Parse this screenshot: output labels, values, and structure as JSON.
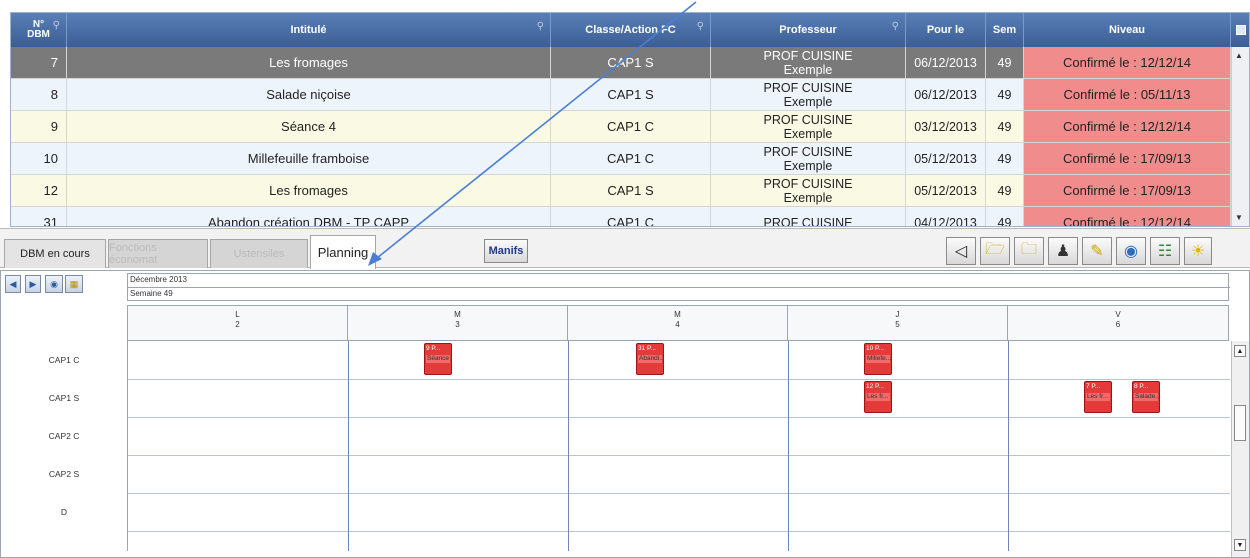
{
  "grid": {
    "headers": {
      "num_line1": "N°",
      "num_line2": "DBM",
      "intitule": "Intitulé",
      "classe": "Classe/Action FC",
      "professeur": "Professeur",
      "pour_le": "Pour le",
      "sem": "Sem",
      "niveau": "Niveau"
    },
    "rows": [
      {
        "num": "7",
        "intitule": "Les fromages",
        "classe": "CAP1 S",
        "prof_line1": "PROF CUISINE",
        "prof_line2": "Exemple",
        "pour_le": "06/12/2013",
        "sem": "49",
        "niveau": "Confirmé le : 12/12/14"
      },
      {
        "num": "8",
        "intitule": "Salade niçoise",
        "classe": "CAP1 S",
        "prof_line1": "PROF CUISINE",
        "prof_line2": "Exemple",
        "pour_le": "06/12/2013",
        "sem": "49",
        "niveau": "Confirmé le : 05/11/13"
      },
      {
        "num": "9",
        "intitule": "Séance 4",
        "classe": "CAP1 C",
        "prof_line1": "PROF CUISINE",
        "prof_line2": "Exemple",
        "pour_le": "03/12/2013",
        "sem": "49",
        "niveau": "Confirmé le : 12/12/14"
      },
      {
        "num": "10",
        "intitule": "Millefeuille framboise",
        "classe": "CAP1 C",
        "prof_line1": "PROF CUISINE",
        "prof_line2": "Exemple",
        "pour_le": "05/12/2013",
        "sem": "49",
        "niveau": "Confirmé le : 17/09/13"
      },
      {
        "num": "12",
        "intitule": "Les fromages",
        "classe": "CAP1 S",
        "prof_line1": "PROF CUISINE",
        "prof_line2": "Exemple",
        "pour_le": "05/12/2013",
        "sem": "49",
        "niveau": "Confirmé le : 17/09/13"
      },
      {
        "num": "31",
        "intitule": "Abandon création DBM - TP CAPP",
        "classe": "CAP1 C",
        "prof_line1": "PROF CUISINE",
        "prof_line2": "",
        "pour_le": "04/12/2013",
        "sem": "49",
        "niveau": "Confirmé le : 12/12/14"
      }
    ]
  },
  "tabs": {
    "dbm": "DBM en cours",
    "fonctions": "Fonctions économat",
    "ustensiles": "Ustensiles",
    "planning": "Planning",
    "manifs": "Manifs"
  },
  "toolbar_icons": [
    "basket-icon",
    "folder-open-icon",
    "folder-icon",
    "person-board-icon",
    "edit-folder-icon",
    "search-globe-icon",
    "tree-icon",
    "lightbulb-icon"
  ],
  "planning": {
    "month": "Décembre 2013",
    "week": "Semaine 49",
    "days": [
      {
        "letter": "L",
        "num": "2"
      },
      {
        "letter": "M",
        "num": "3"
      },
      {
        "letter": "M",
        "num": "4"
      },
      {
        "letter": "J",
        "num": "5"
      },
      {
        "letter": "V",
        "num": "6"
      }
    ],
    "rows": [
      "CAP1 C",
      "CAP1 S",
      "CAP2 C",
      "CAP2 S",
      "D"
    ],
    "events": [
      {
        "title": "9 P...",
        "sub": "Séance 4"
      },
      {
        "title": "31 P...",
        "sub": "Abandi..."
      },
      {
        "title": "10 P...",
        "sub": "Millefe..."
      },
      {
        "title": "12 P...",
        "sub": "Les fr..."
      },
      {
        "title": "7 P...",
        "sub": "Les fr..."
      },
      {
        "title": "8 P...",
        "sub": "Salade..."
      }
    ]
  },
  "colors": {
    "header": "#3a5e95",
    "niveau": "#f08c8c",
    "event": "#e53a3a",
    "selected_row": "#7a7a7a"
  }
}
